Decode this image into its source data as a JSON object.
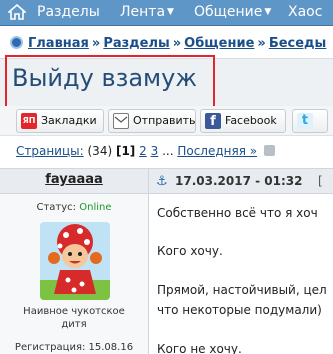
{
  "nav": {
    "items": [
      {
        "label": "Разделы",
        "caret": "▼"
      },
      {
        "label": "Лента",
        "caret": "▼"
      },
      {
        "label": "Общение",
        "caret": "▼"
      },
      {
        "label": "Хаос",
        "caret": ""
      }
    ],
    "bar_color": "#5f96c8"
  },
  "breadcrumb": {
    "items": [
      "Главная",
      "Разделы",
      "Общение",
      "Беседы"
    ],
    "separator": "»"
  },
  "page_title": "Выйду взамуж",
  "share": {
    "buttons": [
      {
        "label": "Закладки",
        "icon": "yandex-bookmarks-icon",
        "icon_text": "ЯП"
      },
      {
        "label": "Отправить",
        "icon": "mail-icon",
        "icon_text": ""
      },
      {
        "label": "Facebook",
        "icon": "facebook-icon",
        "icon_text": "f"
      },
      {
        "label": "",
        "icon": "twitter-icon",
        "icon_text": "t"
      }
    ]
  },
  "pagination": {
    "label": "Страницы:",
    "count": "(34)",
    "current": "[1]",
    "pages": [
      "2",
      "3"
    ],
    "ellipsis": "...",
    "last": "Последняя »"
  },
  "post": {
    "username": "fayaaaa",
    "status_label": "Статус:",
    "status_value": "Online",
    "user_title_line1": "Наивное чукотское",
    "user_title_line2": "дитя",
    "registration": "Регистрация: 15.08.16",
    "date": "17.03.2017 - 01:32",
    "menu_glyph": "[",
    "lines": [
      "Собственно всё что я хоч",
      "Кого хочу.",
      "Прямой, настойчивый, цел",
      "что некоторые подумали)",
      "Кого не хочу."
    ]
  },
  "colors": {
    "accent": "#1a4f8a",
    "highlight_box": "#e0252b",
    "online": "#1c9a2a"
  }
}
